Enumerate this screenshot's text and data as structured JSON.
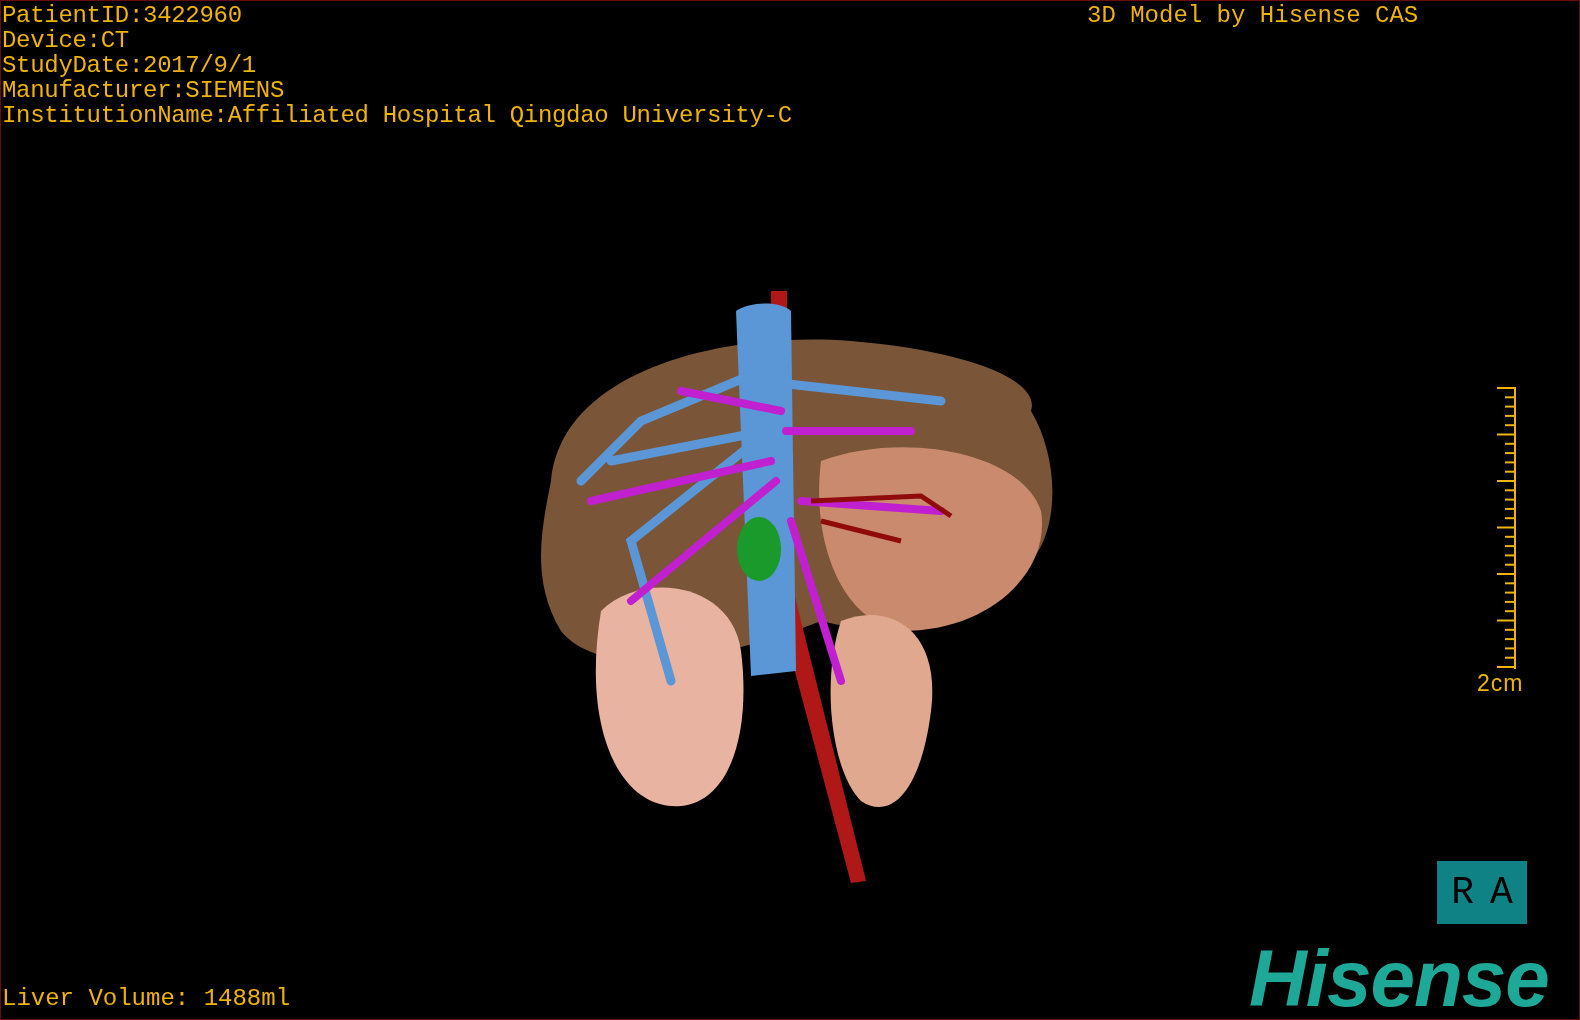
{
  "info_lines": [
    "PatientID:3422960",
    "Device:CT",
    "StudyDate:2017/9/1",
    "Manufacturer:SIEMENS",
    "InstitutionName:Affiliated Hospital Qingdao University-C"
  ],
  "model_caption": "3D Model by Hisense CAS",
  "scale_bar": {
    "label": "2cm"
  },
  "orientation": {
    "left": "R",
    "right": "A"
  },
  "volume": "Liver Volume: 1488ml",
  "logo": "Hisense"
}
